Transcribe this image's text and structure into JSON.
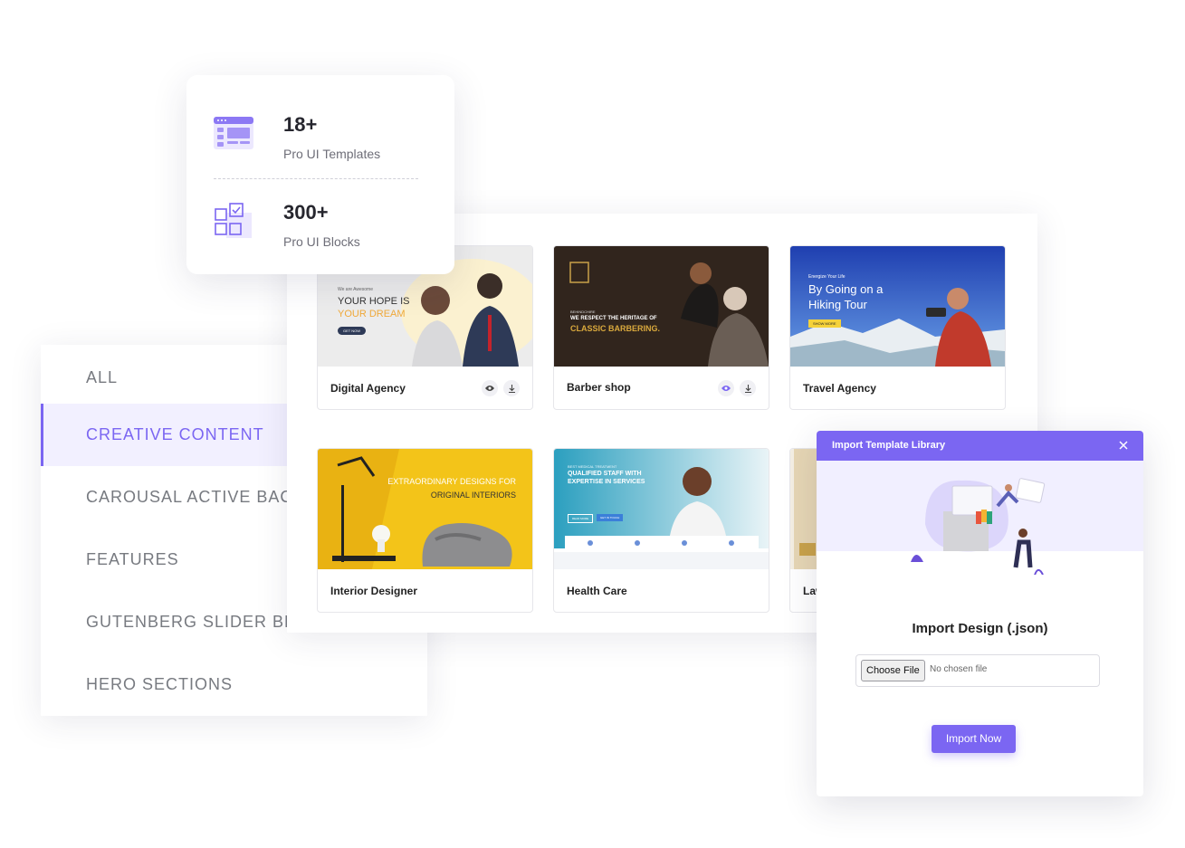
{
  "stats": {
    "templates_count": "18+",
    "templates_label": "Pro UI Templates",
    "blocks_count": "300+",
    "blocks_label": "Pro UI Blocks"
  },
  "categories": [
    {
      "label": "ALL",
      "active": false
    },
    {
      "label": "CREATIVE CONTENT",
      "active": true
    },
    {
      "label": "CAROUSAL ACTIVE BACKGROUND",
      "active": false
    },
    {
      "label": "FEATURES",
      "active": false
    },
    {
      "label": "GUTENBERG SLIDER BLOCK",
      "active": false
    },
    {
      "label": "HERO SECTIONS",
      "active": false
    }
  ],
  "templates": [
    {
      "title": "Digital Agency",
      "thumb": {
        "eyebrow": "We are Awesome",
        "line1": "YOUR HOPE IS",
        "line2": "YOUR DREAM",
        "cta": "GET NOW"
      }
    },
    {
      "title": "Barber shop",
      "thumb": {
        "eyebrow": "BEHINDCHIRE",
        "line1": "WE RESPECT THE HERITAGE OF",
        "line2": "CLASSIC BARBERING."
      }
    },
    {
      "title": "Travel Agency",
      "thumb": {
        "eyebrow": "Energize Your Life",
        "line1": "By Going on a",
        "line2": "Hiking Tour",
        "cta": "SHOW MORE"
      }
    },
    {
      "title": "Interior Designer",
      "thumb": {
        "line1": "EXTRAORDINARY DESIGNS FOR",
        "line2": "ORIGINAL INTERIORS"
      }
    },
    {
      "title": "Health Care",
      "thumb": {
        "eyebrow": "BEST MEDICAL TREATMENT",
        "line1": "QUALIFIED STAFF WITH",
        "line2": "EXPERTISE IN SERVICES",
        "cta": "READ MORE",
        "cta2": "GET IN TOUCH"
      }
    },
    {
      "title": "Law",
      "thumb": {}
    }
  ],
  "import_modal": {
    "title": "Import Template Library",
    "heading": "Import Design (.json)",
    "choose_file": "Choose File",
    "file_status": "No chosen file",
    "submit": "Import Now"
  },
  "colors": {
    "accent": "#7b66f2",
    "accent_light": "#f2f0ff",
    "text_muted": "#777a80"
  }
}
